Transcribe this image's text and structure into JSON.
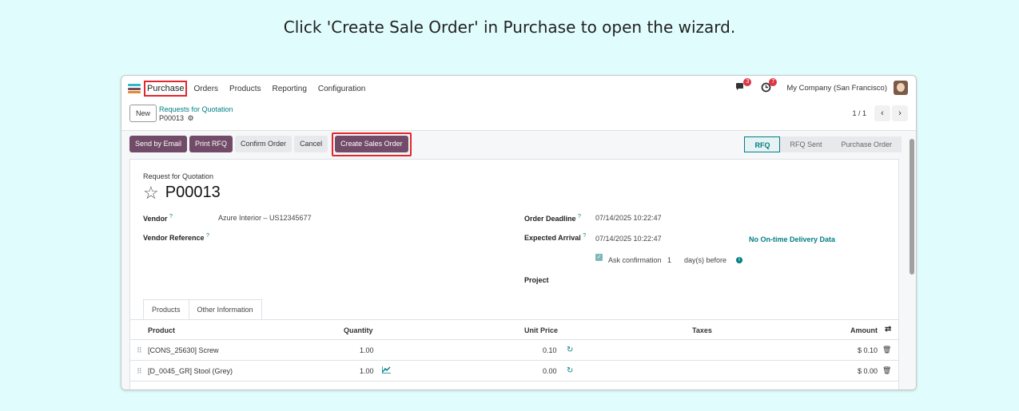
{
  "caption": "Click 'Create Sale Order' in Purchase to open the wizard.",
  "navbar": {
    "app_name": "Purchase",
    "menu": [
      "Orders",
      "Products",
      "Reporting",
      "Configuration"
    ],
    "messages_count": "3",
    "activities_count": "7",
    "company": "My Company (San Francisco)"
  },
  "control": {
    "new_label": "New",
    "breadcrumb": "Requests for Quotation",
    "record": "P00013",
    "pager": "1 / 1"
  },
  "actions": {
    "send_email": "Send by Email",
    "print_rfq": "Print RFQ",
    "confirm_order": "Confirm Order",
    "cancel": "Cancel",
    "create_sales_order": "Create Sales Order"
  },
  "stages": [
    "RFQ",
    "RFQ Sent",
    "Purchase Order"
  ],
  "form": {
    "subtitle": "Request for Quotation",
    "name": "P00013",
    "vendor_label": "Vendor",
    "vendor_value": "Azure Interior – US12345677",
    "vendor_ref_label": "Vendor Reference",
    "order_deadline_label": "Order Deadline",
    "order_deadline_value": "07/14/2025 10:22:47",
    "expected_arrival_label": "Expected Arrival",
    "expected_arrival_value": "07/14/2025 10:22:47",
    "on_time_link": "No On-time Delivery Data",
    "ask_confirmation_label": "Ask confirmation",
    "ask_confirmation_days": "1",
    "days_before": "day(s) before",
    "project_label": "Project",
    "help_mark": "?"
  },
  "tabs": [
    "Products",
    "Other Information"
  ],
  "table": {
    "headers": {
      "product": "Product",
      "quantity": "Quantity",
      "unit_price": "Unit Price",
      "taxes": "Taxes",
      "amount": "Amount"
    },
    "rows": [
      {
        "product": "[CONS_25630] Screw",
        "quantity": "1.00",
        "unit_price": "0.10",
        "amount": "$ 0.10"
      },
      {
        "product": "[D_0045_GR] Stool (Grey)",
        "quantity": "1.00",
        "unit_price": "0.00",
        "amount": "$ 0.00"
      }
    ]
  },
  "colors": {
    "brand": "#714b67",
    "teal": "#017e84",
    "highlight": "#e3262d",
    "background": "#e0fcfd"
  }
}
